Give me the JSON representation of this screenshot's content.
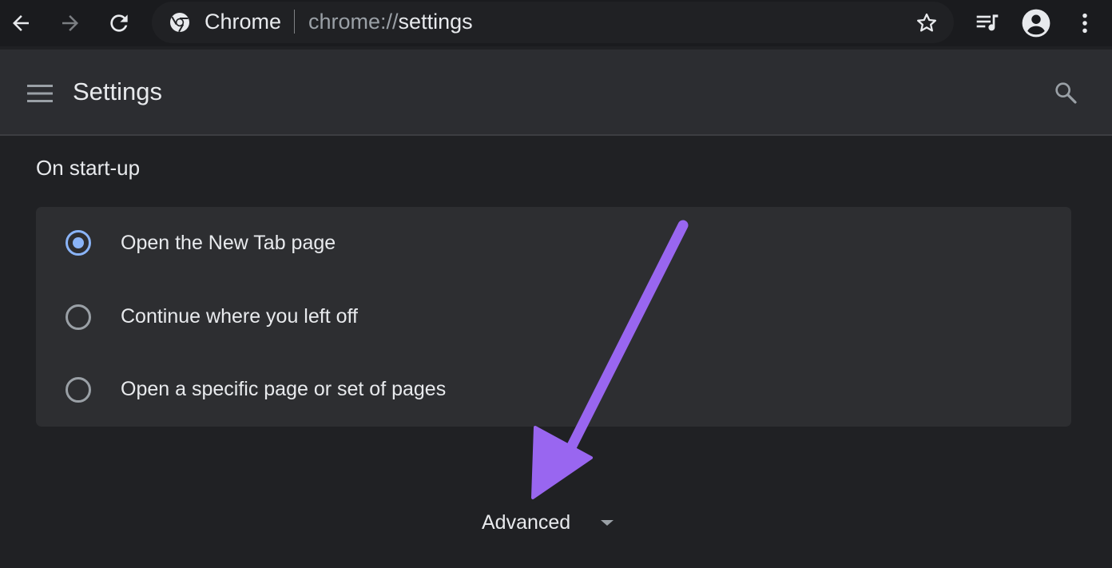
{
  "browser": {
    "omnibox": {
      "site_label": "Chrome",
      "url_scheme": "chrome://",
      "url_path": "settings"
    },
    "icons": [
      "back-arrow-icon",
      "forward-arrow-icon",
      "reload-icon",
      "chrome-logo-icon",
      "star-icon",
      "media-controls-icon",
      "profile-avatar-icon",
      "more-vert-icon"
    ]
  },
  "header": {
    "title": "Settings",
    "menu_icon": "hamburger-menu-icon",
    "search_icon": "search-icon"
  },
  "startup": {
    "section_title": "On start-up",
    "options": [
      {
        "label": "Open the New Tab page",
        "checked": true
      },
      {
        "label": "Continue where you left off",
        "checked": false
      },
      {
        "label": "Open a specific page or set of pages",
        "checked": false
      }
    ]
  },
  "advanced": {
    "label": "Advanced",
    "icon": "caret-down-icon"
  },
  "colors": {
    "background": "#202124",
    "header": "#2c2d31",
    "card": "#2d2e31",
    "accent": "#8ab4f8",
    "annotation_arrow": "#9966f0"
  }
}
